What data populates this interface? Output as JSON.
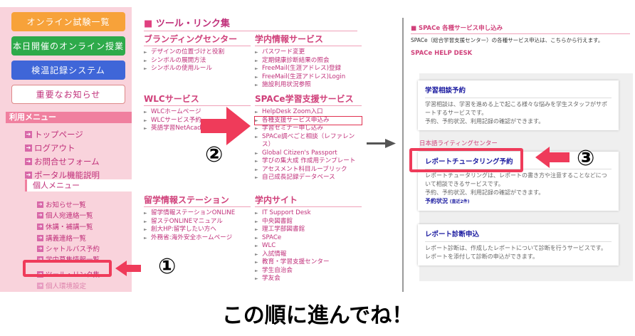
{
  "left": {
    "buttons": [
      {
        "label": "オンライン試験一覧",
        "color": "#f7a23a"
      },
      {
        "label": "本日開催のオンライン授業",
        "color": "#2eaa4a"
      },
      {
        "label": "検温記録システム",
        "color": "#3f66d8"
      },
      {
        "label": "重要なお知らせ",
        "color": "#ffffff"
      }
    ],
    "menu_title": "利用メニュー",
    "menu_items": [
      "トップページ",
      "ログアウト",
      "お問合せフォーム",
      "ポータル機能説明"
    ],
    "personal_title": "個人メニュー",
    "personal_items": [
      "お知らせ一覧",
      "個人宛連絡一覧",
      "休講・補講一覧",
      "講義連絡一覧",
      "シャトルバス予約",
      "学内募集情報一覧",
      "ツール・リンク集",
      "個人環境設定"
    ]
  },
  "mid": {
    "title": "ツール・リンク集",
    "sections": [
      {
        "title": "ブランディングセンター",
        "items": [
          "デザインの位置づけと役割",
          "シンボルの展開方法",
          "シンボルの使用ルール"
        ]
      },
      {
        "title": "学内情報サービス",
        "items": [
          "パスワード変更",
          "定期健康診断結果の照会",
          "FreeMail(生涯アドレス)登録",
          "FreeMail(生涯アドレス)Login",
          "施設利用状況参照"
        ]
      },
      {
        "title": "WLCサービス",
        "items": [
          "WLCホームページ",
          "WLCサービス予約",
          "英語学習NetAcademy"
        ]
      },
      {
        "title": "SPACe学習支援サービス",
        "items": [
          "HelpDesk Zoom入口",
          "各種支援サービス申込み",
          "学習セミナー申し込み",
          "SPACe調べごと相談（レファレンス）",
          "Global Citizen's Passport",
          "学びの集大成 作成用テンプレート",
          "アセスメント科目ルーブリック",
          "自己成長記録データベース"
        ]
      },
      {
        "title": "留学情報ステーション",
        "items": [
          "留学情報ステーションONLINE",
          "留ステONLINEマニュアル",
          "創大HP:留学したい方へ",
          "外務省:海外安全ホームページ"
        ]
      },
      {
        "title": "学内サイト",
        "items": [
          "IT Support Desk",
          "中央図書館",
          "理工学部図書館",
          "SPACe",
          "WLC",
          "入試情報",
          "教育・学習支援センター",
          "学生自治会",
          "学友会"
        ]
      }
    ]
  },
  "right": {
    "title": "■ SPACe 各種サービス申し込み",
    "intro": "SPACe（総合学習支援センター）の各種サービス申込は、こちらから行えます。",
    "helpdesk_heading": "SPACe HELP DESK",
    "card1": {
      "title": "学習相談予約",
      "desc": "学習相談は、学習を進める上で起こる様々な悩みを学生スタッフがサポートするサービスです。",
      "desc2": "予約、予約状況、利用記録の確認ができます。"
    },
    "writing_heading": "日本語ライティングセンター",
    "card2": {
      "title": "レポートチュータリング予約",
      "desc": "レポートチュータリングは、レポートの書き方や注意することなどについて相談できるサービスです。",
      "desc2": "予約、予約状況、利用記録の確認ができます。",
      "link": "予約状況",
      "link_note": "(直近2件)"
    },
    "card3": {
      "title": "レポート診断申込",
      "desc": "レポート診断は、作成したレポートについて診断を行うサービスです。",
      "desc2": "レポートを添付して診断の申込ができます。"
    }
  },
  "steps": [
    "①",
    "②",
    "③"
  ],
  "accent": "#ef3b5a",
  "caption": "この順に進んでね！"
}
